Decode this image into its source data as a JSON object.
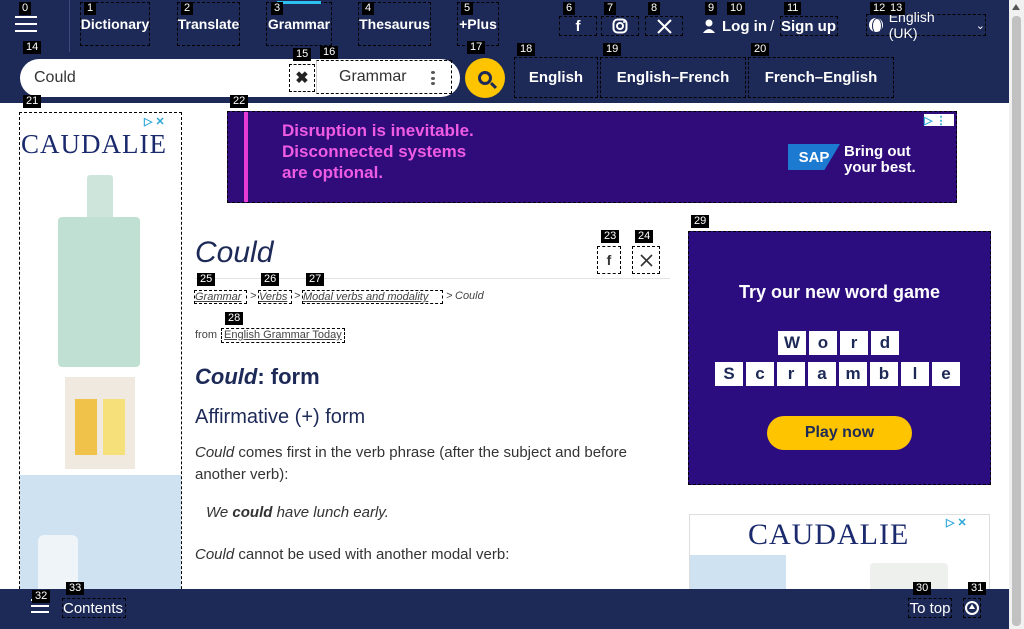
{
  "nav": {
    "tabs": [
      "Dictionary",
      "Translate",
      "Grammar",
      "Thesaurus",
      "+Plus"
    ],
    "login": "Log in",
    "slash": " / ",
    "signup": "Sign up",
    "language": "English (UK)"
  },
  "search": {
    "value": "Could",
    "dictionary": "Grammar"
  },
  "dict_tabs": [
    "English",
    "English–French",
    "French–English"
  ],
  "ads": {
    "left_brand": "CAUDALIE",
    "banner_line1": "Disruption is inevitable.",
    "banner_line2": "Disconnected systems",
    "banner_line3": "are optional.",
    "sap_logo": "SAP",
    "sap_tag1": "Bring out",
    "sap_tag2": "your best.",
    "wordgame_title": "Try our new word game",
    "wordgame_row1": [
      "W",
      "o",
      "r",
      "d"
    ],
    "wordgame_row2": [
      "S",
      "c",
      "r",
      "a",
      "m",
      "b",
      "l",
      "e"
    ],
    "play_now": "Play now",
    "right_brand": "CAUDALIE"
  },
  "article": {
    "title": "Could",
    "breadcrumb": [
      "Grammar",
      "Verbs",
      "Modal verbs and modality"
    ],
    "breadcrumb_current": "Could",
    "sep": ">",
    "from_label": "from",
    "from_link": "English Grammar Today",
    "h2_em": "Could",
    "h2_rest": ": form",
    "h3": "Affirmative (+) form",
    "p1_em": "Could",
    "p1_rest": " comes first in the verb phrase (after the subject and before another verb):",
    "ex1_a": "We ",
    "ex1_b": "could",
    "ex1_c": " have lunch early.",
    "p2_em": "Could",
    "p2_rest": " cannot be used with another modal verb:"
  },
  "footer": {
    "contents": "Contents",
    "to_top": "To top"
  },
  "badges": [
    "0",
    "1",
    "2",
    "3",
    "4",
    "5",
    "6",
    "7",
    "8",
    "9",
    "10",
    "11",
    "12",
    "13",
    "14",
    "15",
    "16",
    "17",
    "18",
    "19",
    "20",
    "21",
    "22",
    "23",
    "24",
    "25",
    "26",
    "27",
    "28",
    "29",
    "30",
    "31",
    "32",
    "33"
  ]
}
